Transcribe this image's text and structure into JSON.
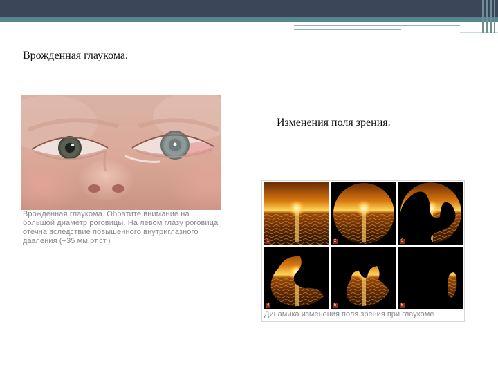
{
  "slide": {
    "title": "Врожденная глаукома.",
    "figure_title": "Изменения поля зрения."
  },
  "photo": {
    "caption": "Врожденная глаукома. Обратите внимание на большой диаметр роговицы. На левом глазу роговица отечна вследствие повышенного внутриглазного давления (+35 мм рт.ст.)"
  },
  "visual_field": {
    "panels": [
      {
        "number": "1"
      },
      {
        "number": "2"
      },
      {
        "number": "3"
      },
      {
        "number": "4"
      },
      {
        "number": "5"
      },
      {
        "number": "6"
      }
    ],
    "caption": "Динамика изменения поля зрения при глаукоме"
  },
  "colors": {
    "header_dark": "#3b4658",
    "header_teal": "#56858f",
    "sunset_orange": "#e8901c"
  }
}
